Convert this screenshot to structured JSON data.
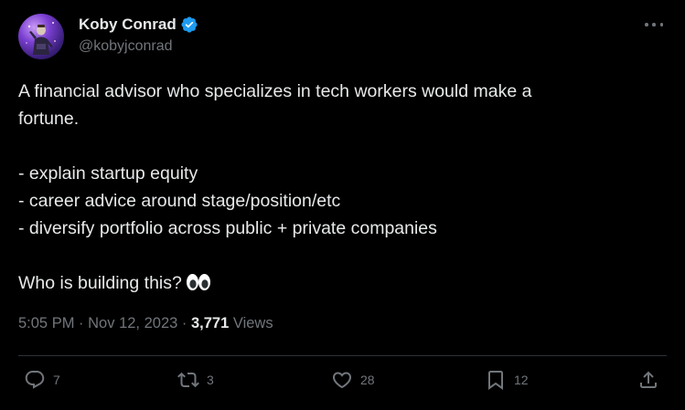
{
  "author": {
    "display_name": "Koby Conrad",
    "handle": "@kobyjconrad",
    "verified": true,
    "verified_color": "#1d9bf0"
  },
  "tweet": {
    "lines": [
      "A financial advisor who specializes in tech workers would make a",
      "fortune.",
      "- explain startup equity",
      "- career advice around stage/position/etc",
      "- diversify portfolio across public + private companies",
      "Who is building this?"
    ],
    "emoji": "eyes-emoji"
  },
  "meta": {
    "time": "5:05 PM",
    "separator": "·",
    "date": "Nov 12, 2023",
    "views_count": "3,771",
    "views_label": "Views"
  },
  "actions": {
    "replies": "7",
    "retweets": "3",
    "likes": "28",
    "bookmarks": "12"
  },
  "colors": {
    "background": "#000000",
    "text_primary": "#e7e9ea",
    "text_secondary": "#71767b",
    "divider": "#2f3336"
  }
}
